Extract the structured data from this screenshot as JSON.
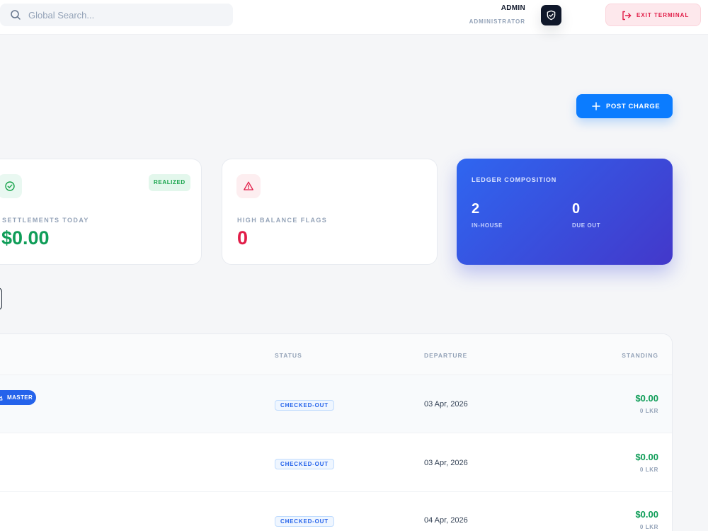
{
  "search": {
    "placeholder": "Global Search..."
  },
  "user": {
    "name": "ADMIN",
    "role": "ADMINISTRATOR"
  },
  "header": {
    "exit_label": "EXIT TERMINAL"
  },
  "actions": {
    "post_charge_label": "POST CHARGE"
  },
  "stats": {
    "settlements": {
      "badge": "REALIZED",
      "label": "SETTLEMENTS TODAY",
      "value": "$0.00"
    },
    "high_balance": {
      "label": "HIGH BALANCE FLAGS",
      "value": "0"
    },
    "ledger": {
      "title": "LEDGER COMPOSITION",
      "in_house_value": "2",
      "in_house_label": "IN-HOUSE",
      "due_out_value": "0",
      "due_out_label": "DUE OUT"
    }
  },
  "table": {
    "columns": {
      "status": "STATUS",
      "departure": "DEPARTURE",
      "standing": "STANDING"
    },
    "rows": [
      {
        "tag": "MASTER",
        "status": "CHECKED-OUT",
        "departure": "03 Apr, 2026",
        "amount": "$0.00",
        "currency": "0 LKR"
      },
      {
        "status": "CHECKED-OUT",
        "departure": "03 Apr, 2026",
        "amount": "$0.00",
        "currency": "0 LKR"
      },
      {
        "status": "CHECKED-OUT",
        "departure": "04 Apr, 2026",
        "amount": "$0.00",
        "currency": "0 LKR"
      }
    ]
  },
  "colors": {
    "accent": "#0b7cff",
    "success": "#0f9d58",
    "danger": "#e11d48",
    "ledger_gradient_start": "#2f66f0",
    "ledger_gradient_end": "#4338ca"
  }
}
